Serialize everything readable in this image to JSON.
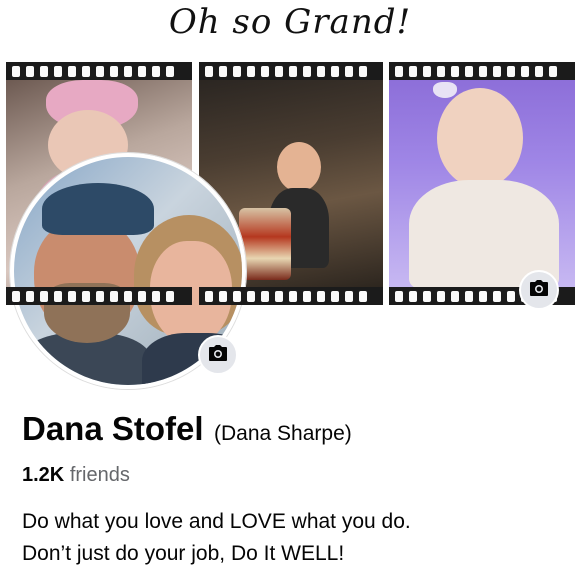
{
  "cover": {
    "title": "Oh so Grand!"
  },
  "profile": {
    "name": "Dana Stofel",
    "alternate_name": "(Dana Sharpe)",
    "friends_count": "1.2K",
    "friends_label": "friends",
    "bio_line1": "Do what you love and LOVE what you do.",
    "bio_line2": "Don’t just do your job, Do It WELL!"
  },
  "icons": {
    "avatar_camera": "camera-icon",
    "cover_camera": "camera-icon"
  },
  "colors": {
    "name_text": "#050505",
    "secondary_text": "#65676b",
    "camera_button_bg": "#e4e6eb"
  }
}
